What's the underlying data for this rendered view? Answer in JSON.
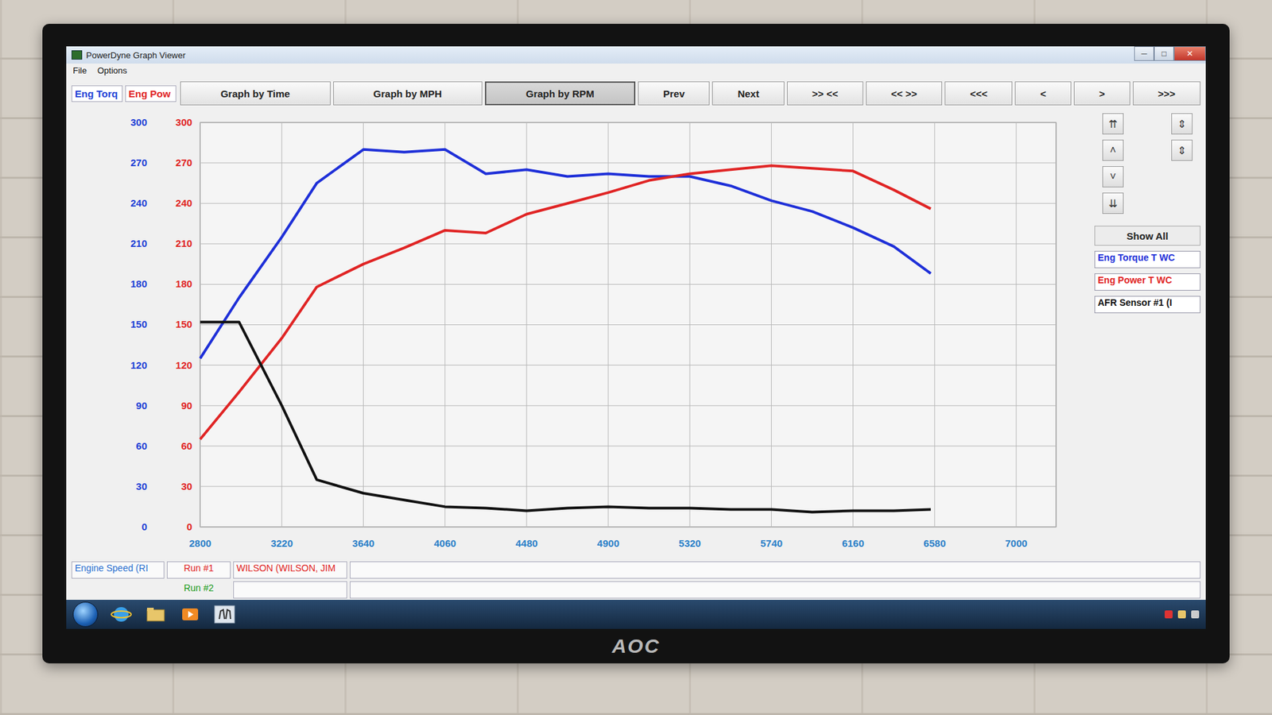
{
  "window": {
    "title": "PowerDyne Graph Viewer",
    "controls": [
      "─",
      "□",
      "✕"
    ]
  },
  "menu": [
    "File",
    "Options"
  ],
  "axis_headers": [
    {
      "label": "Eng Torq",
      "color": "#1d3fd6"
    },
    {
      "label": "Eng Pow",
      "color": "#e02424"
    }
  ],
  "toolbar": [
    {
      "label": "Graph by Time",
      "selected": false
    },
    {
      "label": "Graph by MPH",
      "selected": false
    },
    {
      "label": "Graph by RPM",
      "selected": true
    },
    {
      "label": "Prev",
      "selected": false
    },
    {
      "label": "Next",
      "selected": false
    },
    {
      "label": ">> <<",
      "selected": false
    },
    {
      "label": "<< >>",
      "selected": false
    },
    {
      "label": "<<<",
      "selected": false
    },
    {
      "label": "<",
      "selected": false
    },
    {
      "label": ">",
      "selected": false
    },
    {
      "label": ">>>",
      "selected": false
    }
  ],
  "chart": {
    "y_axes": [
      {
        "name": "Eng Torq",
        "color": "#1d3fd6",
        "ticks": [
          "300",
          "270",
          "240",
          "210",
          "180",
          "150",
          "120",
          "90",
          "60",
          "30",
          "0"
        ]
      },
      {
        "name": "Eng Pow",
        "color": "#e02424",
        "ticks": [
          "300",
          "270",
          "240",
          "210",
          "180",
          "150",
          "120",
          "90",
          "60",
          "30",
          "0"
        ]
      }
    ],
    "x_ticks": [
      "2800",
      "3220",
      "3640",
      "4060",
      "4480",
      "4900",
      "5320",
      "5740",
      "6160",
      "6580",
      "7000"
    ],
    "rpm": [
      2800,
      3000,
      3220,
      3400,
      3640,
      3850,
      4060,
      4270,
      4480,
      4690,
      4900,
      5110,
      5320,
      5530,
      5740,
      5950,
      6160,
      6370,
      6560
    ],
    "series": [
      {
        "name": "Eng Torque T WC",
        "color": "#1e2fd8",
        "values": [
          125,
          170,
          215,
          255,
          280,
          278,
          280,
          262,
          265,
          260,
          262,
          260,
          260,
          253,
          242,
          234,
          222,
          208,
          188
        ]
      },
      {
        "name": "Eng Power T WC",
        "color": "#e02424",
        "values": [
          65,
          100,
          140,
          178,
          195,
          207,
          220,
          218,
          232,
          240,
          248,
          257,
          262,
          265,
          268,
          266,
          264,
          250,
          236
        ]
      },
      {
        "name": "AFR Sensor #1 (I",
        "color": "#111111",
        "values": [
          152,
          152,
          90,
          35,
          25,
          20,
          15,
          14,
          12,
          14,
          15,
          14,
          14,
          13,
          13,
          11,
          12,
          12,
          13
        ]
      }
    ]
  },
  "side_panel": {
    "zoom_left": [
      "⇈",
      "˄",
      "˅",
      "⇊"
    ],
    "zoom_right": [
      "⇕",
      "⇕"
    ],
    "show_all": "Show All"
  },
  "x_axis_label": "Engine Speed (RI",
  "runs": [
    {
      "label": "Run #1",
      "color": "#e02424",
      "driver": "WILSON (WILSON, JIM"
    },
    {
      "label": "Run #2",
      "color": "#1a9a1a",
      "driver": ""
    }
  ],
  "monitor": {
    "brand": "AOC"
  }
}
